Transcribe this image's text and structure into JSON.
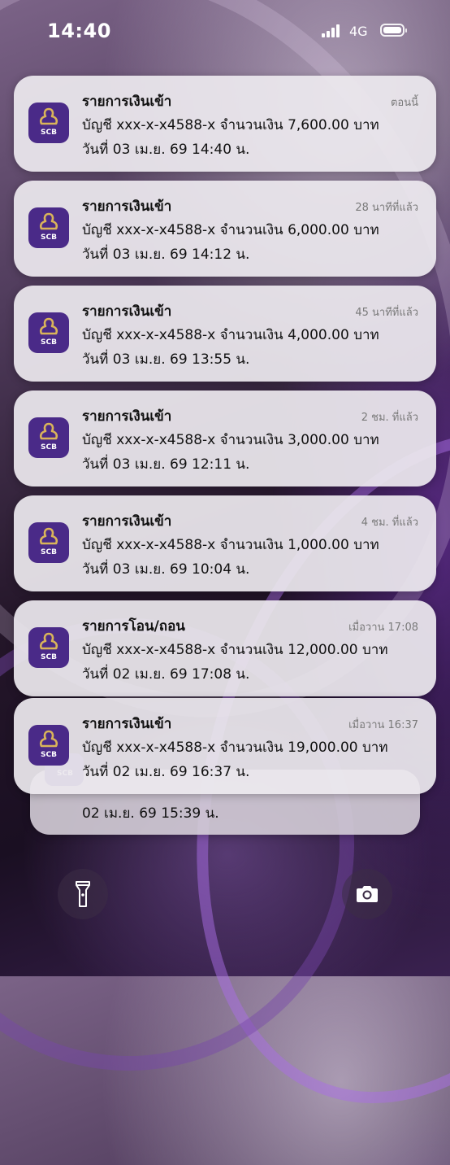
{
  "status_bar": {
    "time": "14:40",
    "network": "4G"
  },
  "notifications": [
    {
      "title": "รายการเงินเข้า",
      "time": "ตอนนี้",
      "line1": "บัญชี xxx-x-x4588-x จำนวนเงิน 7,600.00 บาท",
      "line2": "วันที่ 03 เม.ย. 69 14:40 น."
    },
    {
      "title": "รายการเงินเข้า",
      "time": "28 นาทีที่แล้ว",
      "line1": "บัญชี xxx-x-x4588-x จำนวนเงิน 6,000.00 บาท",
      "line2": "วันที่ 03 เม.ย. 69 14:12 น."
    },
    {
      "title": "รายการเงินเข้า",
      "time": "45 นาทีที่แล้ว",
      "line1": "บัญชี xxx-x-x4588-x จำนวนเงิน 4,000.00 บาท",
      "line2": "วันที่ 03 เม.ย. 69 13:55 น."
    },
    {
      "title": "รายการเงินเข้า",
      "time": "2 ชม. ที่แล้ว",
      "line1": "บัญชี xxx-x-x4588-x จำนวนเงิน 3,000.00 บาท",
      "line2": "วันที่ 03 เม.ย. 69 12:11 น."
    },
    {
      "title": "รายการเงินเข้า",
      "time": "4 ชม. ที่แล้ว",
      "line1": "บัญชี xxx-x-x4588-x จำนวนเงิน 1,000.00 บาท",
      "line2": "วันที่ 03 เม.ย. 69 10:04 น."
    },
    {
      "title": "รายการโอน/ถอน",
      "time": "เมื่อวาน 17:08",
      "line1": "บัญชี xxx-x-x4588-x จำนวนเงิน 12,000.00 บาท",
      "line2": "วันที่ 02 เม.ย. 69 17:08 น."
    },
    {
      "title": "รายการเงินเข้า",
      "time": "เมื่อวาน 16:37",
      "line1": "บัญชี xxx-x-x4588-x จำนวนเงิน 19,000.00 บาท",
      "line2": "วันที่ 02 เม.ย. 69 16:37 น."
    }
  ],
  "stacked_notification": {
    "line": "02 เม.ย. 69 15:39 น."
  },
  "app": {
    "icon_label": "SCB",
    "icon_color": "#4a2a88",
    "icon_accent": "#d9b45a"
  },
  "controls": {
    "left_icon": "flashlight-icon",
    "right_icon": "camera-icon"
  }
}
